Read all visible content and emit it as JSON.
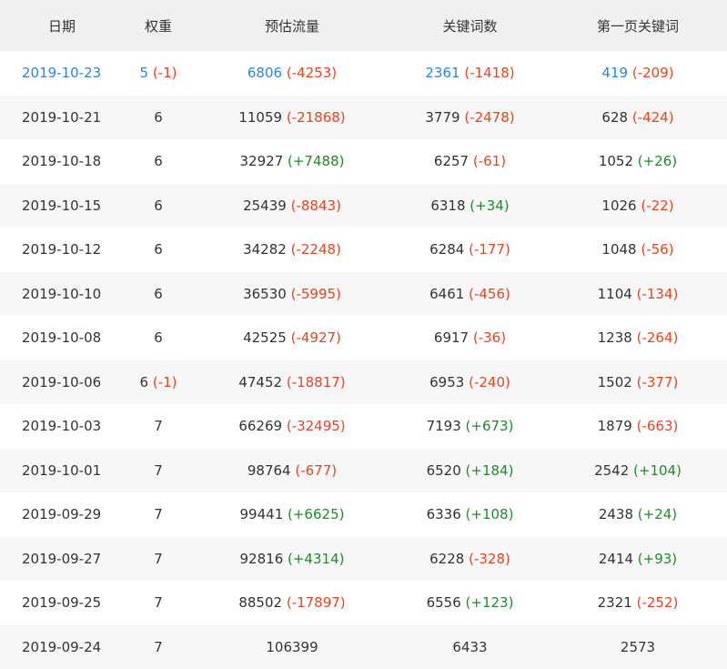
{
  "table": {
    "headers": [
      "日期",
      "权重",
      "预估流量",
      "关键词数",
      "第一页关键词"
    ],
    "rows": [
      {
        "date": "2019-10-23",
        "weight": "5",
        "weight_delta": "(-1)",
        "traffic": "6806",
        "traffic_delta": "(-4253)",
        "keywords": "2361",
        "keywords_delta": "(-1418)",
        "first_page": "419",
        "first_page_delta": "(-209)"
      },
      {
        "date": "2019-10-21",
        "weight": "6",
        "weight_delta": "",
        "traffic": "11059",
        "traffic_delta": "(-21868)",
        "keywords": "3779",
        "keywords_delta": "(-2478)",
        "first_page": "628",
        "first_page_delta": "(-424)"
      },
      {
        "date": "2019-10-18",
        "weight": "6",
        "weight_delta": "",
        "traffic": "32927",
        "traffic_delta": "(+7488)",
        "keywords": "6257",
        "keywords_delta": "(-61)",
        "first_page": "1052",
        "first_page_delta": "(+26)"
      },
      {
        "date": "2019-10-15",
        "weight": "6",
        "weight_delta": "",
        "traffic": "25439",
        "traffic_delta": "(-8843)",
        "keywords": "6318",
        "keywords_delta": "(+34)",
        "first_page": "1026",
        "first_page_delta": "(-22)"
      },
      {
        "date": "2019-10-12",
        "weight": "6",
        "weight_delta": "",
        "traffic": "34282",
        "traffic_delta": "(-2248)",
        "keywords": "6284",
        "keywords_delta": "(-177)",
        "first_page": "1048",
        "first_page_delta": "(-56)"
      },
      {
        "date": "2019-10-10",
        "weight": "6",
        "weight_delta": "",
        "traffic": "36530",
        "traffic_delta": "(-5995)",
        "keywords": "6461",
        "keywords_delta": "(-456)",
        "first_page": "1104",
        "first_page_delta": "(-134)"
      },
      {
        "date": "2019-10-08",
        "weight": "6",
        "weight_delta": "",
        "traffic": "42525",
        "traffic_delta": "(-4927)",
        "keywords": "6917",
        "keywords_delta": "(-36)",
        "first_page": "1238",
        "first_page_delta": "(-264)"
      },
      {
        "date": "2019-10-06",
        "weight": "6",
        "weight_delta": "(-1)",
        "traffic": "47452",
        "traffic_delta": "(-18817)",
        "keywords": "6953",
        "keywords_delta": "(-240)",
        "first_page": "1502",
        "first_page_delta": "(-377)"
      },
      {
        "date": "2019-10-03",
        "weight": "7",
        "weight_delta": "",
        "traffic": "66269",
        "traffic_delta": "(-32495)",
        "keywords": "7193",
        "keywords_delta": "(+673)",
        "first_page": "1879",
        "first_page_delta": "(-663)"
      },
      {
        "date": "2019-10-01",
        "weight": "7",
        "weight_delta": "",
        "traffic": "98764",
        "traffic_delta": "(-677)",
        "keywords": "6520",
        "keywords_delta": "(+184)",
        "first_page": "2542",
        "first_page_delta": "(+104)"
      },
      {
        "date": "2019-09-29",
        "weight": "7",
        "weight_delta": "",
        "traffic": "99441",
        "traffic_delta": "(+6625)",
        "keywords": "6336",
        "keywords_delta": "(+108)",
        "first_page": "2438",
        "first_page_delta": "(+24)"
      },
      {
        "date": "2019-09-27",
        "weight": "7",
        "weight_delta": "",
        "traffic": "92816",
        "traffic_delta": "(+4314)",
        "keywords": "6228",
        "keywords_delta": "(-328)",
        "first_page": "2414",
        "first_page_delta": "(+93)"
      },
      {
        "date": "2019-09-25",
        "weight": "7",
        "weight_delta": "",
        "traffic": "88502",
        "traffic_delta": "(-17897)",
        "keywords": "6556",
        "keywords_delta": "(+123)",
        "first_page": "2321",
        "first_page_delta": "(-252)"
      },
      {
        "date": "2019-09-24",
        "weight": "7",
        "weight_delta": "",
        "traffic": "106399",
        "traffic_delta": "",
        "keywords": "6433",
        "keywords_delta": "",
        "first_page": "2573",
        "first_page_delta": ""
      }
    ]
  },
  "colors": {
    "highlight": "#2f86d1",
    "negative": "#e8441d",
    "positive": "#1e8a2a",
    "header_bg": "#f0f0f0",
    "stripe_bg": "#f7f7f7"
  }
}
